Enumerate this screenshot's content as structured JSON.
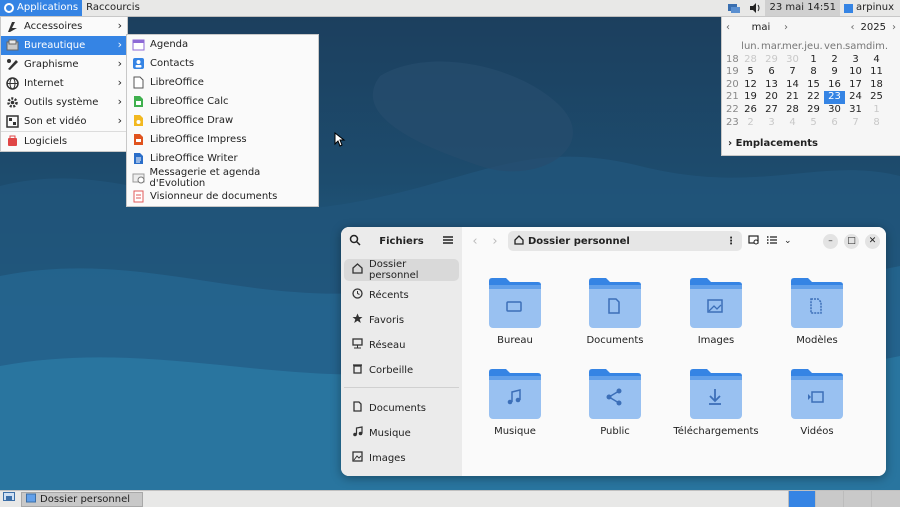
{
  "top_panel": {
    "applications": "Applications",
    "shortcuts": "Raccourcis",
    "clock": "23 mai  14:51",
    "user": "arpinux"
  },
  "main_menu": {
    "items": [
      {
        "label": "Accessoires",
        "icon": "accessories-icon"
      },
      {
        "label": "Bureautique",
        "icon": "office-icon"
      },
      {
        "label": "Graphisme",
        "icon": "graphics-icon"
      },
      {
        "label": "Internet",
        "icon": "internet-icon"
      },
      {
        "label": "Outils système",
        "icon": "system-tools-icon"
      },
      {
        "label": "Son et vidéo",
        "icon": "multimedia-icon"
      },
      {
        "label": "Logiciels",
        "icon": "software-icon"
      }
    ]
  },
  "sub_menu": {
    "items": [
      {
        "label": "Agenda",
        "icon": "calendar-icon",
        "color": "#8e6ad6"
      },
      {
        "label": "Contacts",
        "icon": "contacts-icon",
        "color": "#3584e4"
      },
      {
        "label": "LibreOffice",
        "icon": "libreoffice-icon",
        "color": "#ffffff"
      },
      {
        "label": "LibreOffice Calc",
        "icon": "calc-icon",
        "color": "#3fb04e"
      },
      {
        "label": "LibreOffice Draw",
        "icon": "draw-icon",
        "color": "#f2b820"
      },
      {
        "label": "LibreOffice Impress",
        "icon": "impress-icon",
        "color": "#e0531e"
      },
      {
        "label": "LibreOffice Writer",
        "icon": "writer-icon",
        "color": "#2b6ec9"
      },
      {
        "label": "Messagerie et agenda d'Evolution",
        "icon": "evolution-icon",
        "color": "#a0a0a0"
      },
      {
        "label": "Visionneur de documents",
        "icon": "document-viewer-icon",
        "color": "#e05a5a"
      }
    ]
  },
  "calendar": {
    "month": "mai",
    "year": "2025",
    "weekdays": [
      "lun.",
      "mar.",
      "mer.",
      "jeu.",
      "ven.",
      "sam.",
      "dim."
    ],
    "weeks": [
      {
        "wk": "18",
        "days": [
          "28",
          "29",
          "30",
          "1",
          "2",
          "3",
          "4"
        ]
      },
      {
        "wk": "19",
        "days": [
          "5",
          "6",
          "7",
          "8",
          "9",
          "10",
          "11"
        ]
      },
      {
        "wk": "20",
        "days": [
          "12",
          "13",
          "14",
          "15",
          "16",
          "17",
          "18"
        ]
      },
      {
        "wk": "21",
        "days": [
          "19",
          "20",
          "21",
          "22",
          "23",
          "24",
          "25"
        ]
      },
      {
        "wk": "22",
        "days": [
          "26",
          "27",
          "28",
          "29",
          "30",
          "31",
          "1"
        ]
      },
      {
        "wk": "23",
        "days": [
          "2",
          "3",
          "4",
          "5",
          "6",
          "7",
          "8"
        ]
      }
    ],
    "places": "Emplacements"
  },
  "file_manager": {
    "title": "Fichiers",
    "path": "Dossier personnel",
    "sidebar": [
      {
        "label": "Dossier personnel",
        "icon": "home-icon"
      },
      {
        "label": "Récents",
        "icon": "recent-icon"
      },
      {
        "label": "Favoris",
        "icon": "star-icon"
      },
      {
        "label": "Réseau",
        "icon": "network-icon"
      },
      {
        "label": "Corbeille",
        "icon": "trash-icon"
      }
    ],
    "sidebar_places": [
      {
        "label": "Documents",
        "icon": "documents-icon"
      },
      {
        "label": "Musique",
        "icon": "music-icon"
      },
      {
        "label": "Images",
        "icon": "images-icon"
      }
    ],
    "folders": [
      {
        "label": "Bureau",
        "icon": "desktop-folder-icon"
      },
      {
        "label": "Documents",
        "icon": "documents-folder-icon"
      },
      {
        "label": "Images",
        "icon": "images-folder-icon"
      },
      {
        "label": "Modèles",
        "icon": "templates-folder-icon"
      },
      {
        "label": "Musique",
        "icon": "music-folder-icon"
      },
      {
        "label": "Public",
        "icon": "public-folder-icon"
      },
      {
        "label": "Téléchargements",
        "icon": "downloads-folder-icon"
      },
      {
        "label": "Vidéos",
        "icon": "videos-folder-icon"
      }
    ]
  },
  "bottom_panel": {
    "task": "Dossier personnel"
  },
  "colors": {
    "accent": "#3584e4",
    "folder": "#62a0ea",
    "folder_light": "#99c1f1"
  }
}
